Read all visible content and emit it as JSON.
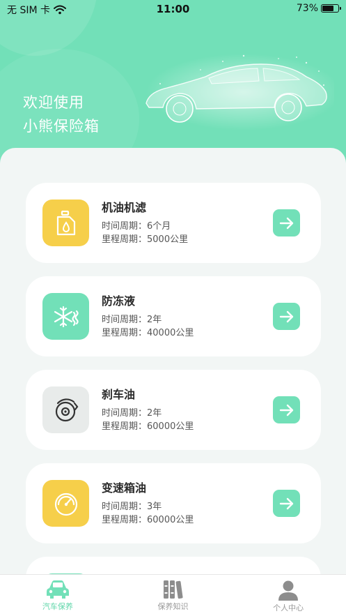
{
  "status_bar": {
    "carrier": "无 SIM 卡",
    "time": "11:00",
    "battery_text": "73%",
    "battery_level": 0.73
  },
  "header": {
    "line1": "欢迎使用",
    "line2": "小熊保险箱"
  },
  "cards": [
    {
      "title": "机油机滤",
      "time_cycle": "时间周期：6个月",
      "mileage_cycle": "里程周期：5000公里",
      "icon": "oil-bottle-icon",
      "icon_bg": "#f6cf4a"
    },
    {
      "title": "防冻液",
      "time_cycle": "时间周期：2年",
      "mileage_cycle": "里程周期：40000公里",
      "icon": "snowflake-icon",
      "icon_bg": "#72e0b8"
    },
    {
      "title": "刹车油",
      "time_cycle": "时间周期：2年",
      "mileage_cycle": "里程周期：60000公里",
      "icon": "brake-disc-icon",
      "icon_bg": "#e8ebea"
    },
    {
      "title": "变速箱油",
      "time_cycle": "时间周期：3年",
      "mileage_cycle": "里程周期：60000公里",
      "icon": "speedometer-icon",
      "icon_bg": "#f6cf4a"
    }
  ],
  "tabs": [
    {
      "label": "汽车保养",
      "icon": "car-icon",
      "active": true
    },
    {
      "label": "保养知识",
      "icon": "books-icon",
      "active": false
    },
    {
      "label": "个人中心",
      "icon": "user-icon",
      "active": false
    }
  ],
  "colors": {
    "accent": "#72e0b8",
    "accent_text": "#5fd6aa",
    "yellow": "#f6cf4a",
    "inactive": "#8d8d8d"
  }
}
